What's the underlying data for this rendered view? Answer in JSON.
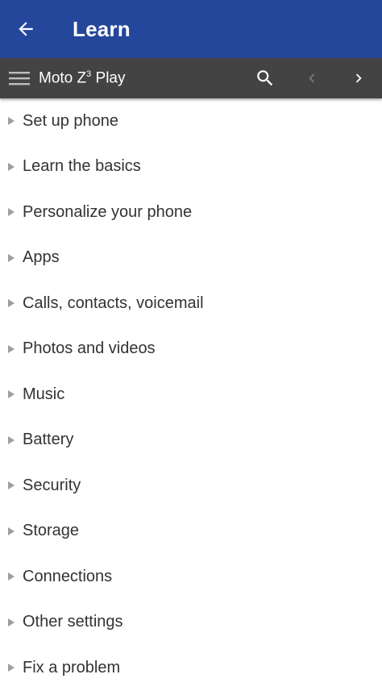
{
  "app_bar": {
    "title": "Learn",
    "background": "#24469b"
  },
  "toolbar": {
    "device_name": "Moto Z",
    "device_superscript": "3",
    "device_suffix": " Play",
    "background": "#434343"
  },
  "icons": {
    "back": "arrow-left-icon",
    "menu": "hamburger-menu-icon",
    "search": "search-icon",
    "previous": "chevron-left-icon",
    "next": "chevron-right-icon",
    "item_bullet": "triangle-right-icon"
  },
  "topics": [
    {
      "label": "Set up phone"
    },
    {
      "label": "Learn the basics"
    },
    {
      "label": "Personalize your phone"
    },
    {
      "label": "Apps"
    },
    {
      "label": "Calls, contacts, voicemail"
    },
    {
      "label": "Photos and videos"
    },
    {
      "label": "Music"
    },
    {
      "label": "Battery"
    },
    {
      "label": "Security"
    },
    {
      "label": "Storage"
    },
    {
      "label": "Connections"
    },
    {
      "label": "Other settings"
    },
    {
      "label": "Fix a problem"
    }
  ]
}
